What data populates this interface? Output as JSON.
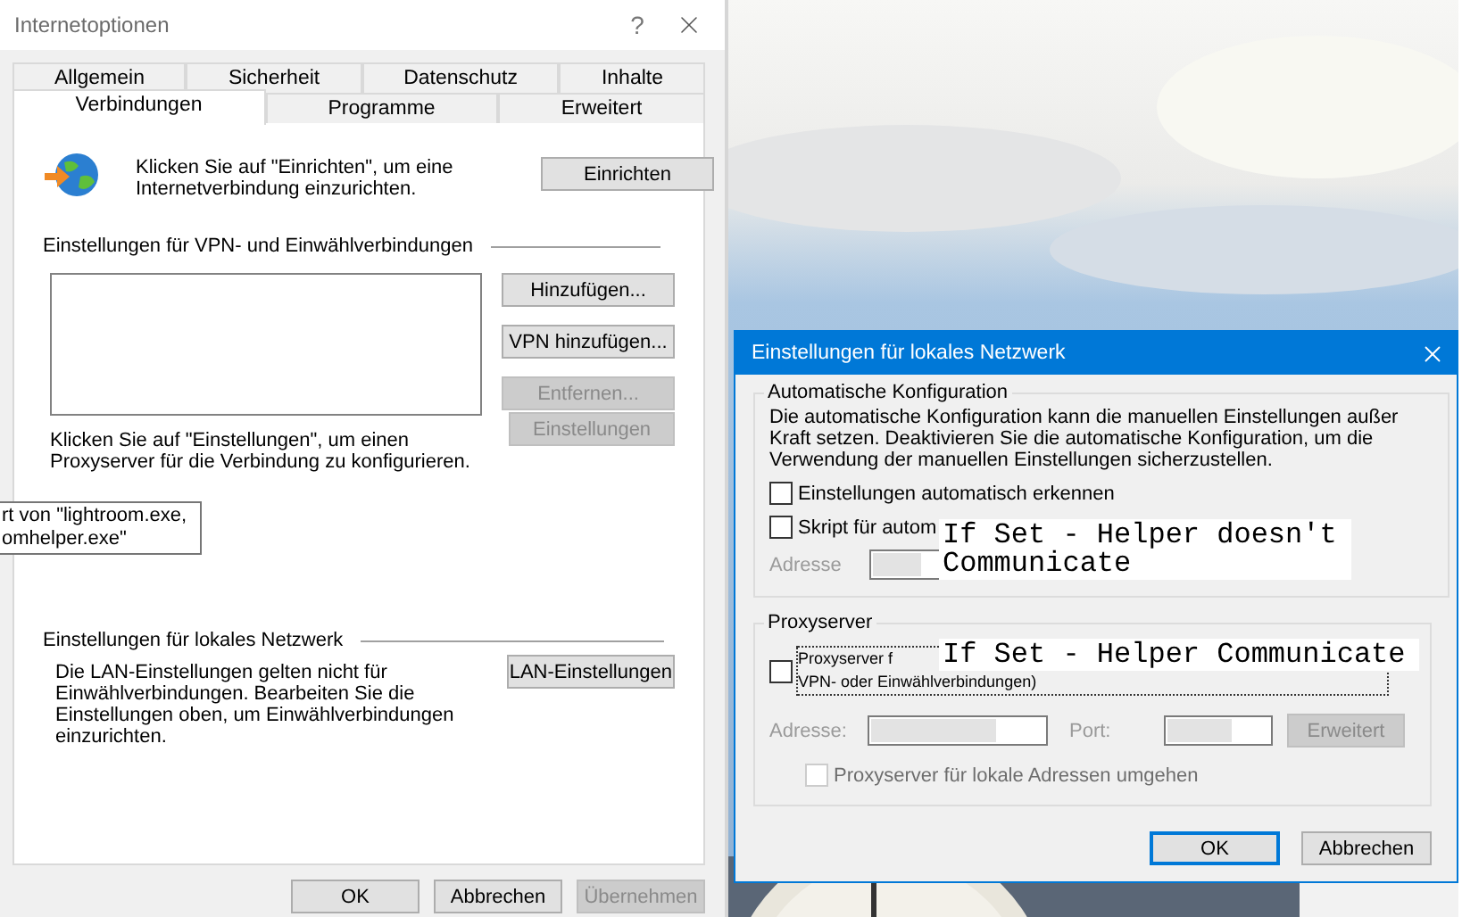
{
  "internet_options": {
    "title": "Internetoptionen",
    "help": "?",
    "tab_rows": [
      [
        {
          "label": "Allgemein",
          "selected": false
        },
        {
          "label": "Sicherheit",
          "selected": false
        },
        {
          "label": "Datenschutz",
          "selected": false
        },
        {
          "label": "Inhalte",
          "selected": false
        }
      ],
      [
        {
          "label": "Verbindungen",
          "selected": true
        },
        {
          "label": "Programme",
          "selected": false
        },
        {
          "label": "Erweitert",
          "selected": false
        }
      ]
    ],
    "setup": {
      "text": "Klicken Sie auf \"Einrichten\", um eine Internetverbindung einzurichten.",
      "button": {
        "label": "Einrichten",
        "disabled": false
      }
    },
    "vpn": {
      "title": "Einstellungen für VPN- und Einwählverbindungen",
      "buttons": [
        {
          "label": "Hinzufügen...",
          "disabled": false
        },
        {
          "label": "VPN hinzufügen...",
          "disabled": false
        },
        {
          "label": "Entfernen...",
          "disabled": true
        }
      ],
      "note": "Klicken Sie auf \"Einstellungen\", um einen Proxyserver für die Verbindung zu konfigurieren.",
      "settings_button": {
        "label": "Einstellungen",
        "disabled": true
      }
    },
    "lan": {
      "title": "Einstellungen für lokales Netzwerk",
      "text": "Die LAN-Einstellungen gelten nicht für Einwählverbindungen. Bearbeiten Sie die Einstellungen oben, um Einwählverbindungen einzurichten.",
      "button": {
        "label": "LAN-Einstellungen",
        "disabled": false
      }
    },
    "buttons": [
      {
        "label": "OK",
        "disabled": false,
        "default": false
      },
      {
        "label": "Abbrechen",
        "disabled": false,
        "default": false
      },
      {
        "label": "Übernehmen",
        "disabled": true,
        "default": false
      }
    ]
  },
  "tooltip": {
    "lines": [
      "rt von \"lightroom.exe,",
      "omhelper.exe\""
    ]
  },
  "lan_dialog": {
    "title": "Einstellungen für lokales Netzwerk",
    "auto_config": {
      "title": "Automatische Konfiguration",
      "text": "Die automatische Konfiguration kann die manuellen Einstellungen außer Kraft setzen. Deaktivieren Sie die automatische Konfiguration, um die Verwendung der manuellen Einstellungen sicherzustellen.",
      "options": [
        {
          "label": "Einstellungen automatisch erkennen",
          "checked": false,
          "disabled": false
        },
        {
          "label": "Skript für autom",
          "checked": false,
          "disabled": false
        }
      ],
      "address": {
        "label": "Adresse",
        "disabled": true
      }
    },
    "proxy": {
      "title": "Proxyserver",
      "use_proxy": {
        "label_lines": [
          "Proxyserver f",
          "VPN- oder Einwählverbindungen)"
        ],
        "checked": false
      },
      "address": {
        "label": "Adresse:",
        "disabled": true
      },
      "port": {
        "label": "Port:",
        "disabled": true
      },
      "advanced": {
        "label": "Erweitert",
        "disabled": true
      },
      "bypass": {
        "label": "Proxyserver für lokale Adressen umgehen",
        "checked": false,
        "disabled": true
      }
    },
    "buttons": [
      {
        "label": "OK",
        "disabled": false,
        "default": true
      },
      {
        "label": "Abbrechen",
        "disabled": false,
        "default": false
      }
    ]
  },
  "annotations": [
    {
      "lines": [
        "If Set - Helper doesn't",
        "Communicate"
      ]
    },
    {
      "lines": [
        "If Set - Helper Communicate"
      ]
    }
  ]
}
